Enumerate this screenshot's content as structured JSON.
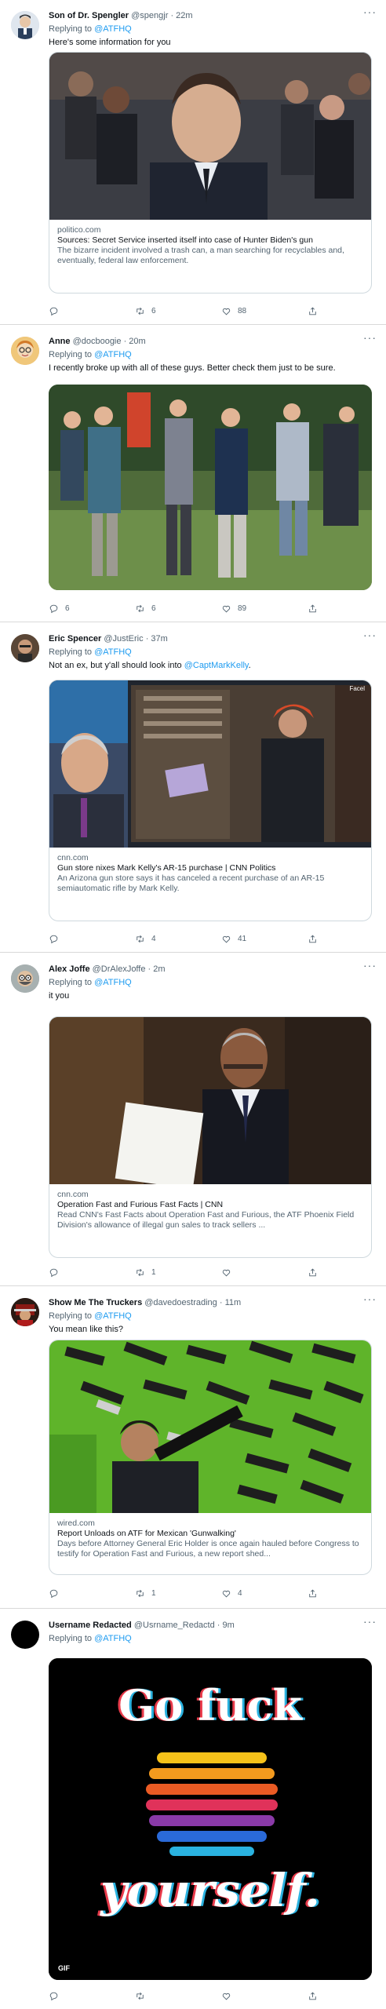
{
  "tweets": [
    {
      "name": "Son of Dr. Spengler",
      "handle": "@spengjr",
      "time": "· 22m",
      "replying_label": "Replying to",
      "replying_to": "@ATFHQ",
      "text": "Here's some information for you",
      "card": {
        "domain": "politico.com",
        "title": "Sources: Secret Service inserted itself into case of Hunter Biden's gun",
        "desc": "The bizarre incident involved a trash can, a man searching for recyclables and, eventually, federal law enforcement."
      },
      "counts": {
        "replies": "",
        "retweets": "6",
        "likes": "88"
      }
    },
    {
      "name": "Anne",
      "handle": "@docboogie",
      "time": "· 20m",
      "replying_label": "Replying to",
      "replying_to": "@ATFHQ",
      "text": "I recently broke up with all of these guys. Better check them just to be sure.",
      "counts": {
        "replies": "6",
        "retweets": "6",
        "likes": "89"
      }
    },
    {
      "name": "Eric Spencer",
      "handle": "@JustEric",
      "time": "· 37m",
      "replying_label": "Replying to",
      "replying_to": "@ATFHQ",
      "text_pre": "Not an ex, but y'all should look into ",
      "text_mention": "@CaptMarkKelly",
      "text_post": ".",
      "card": {
        "domain": "cnn.com",
        "title": "Gun store nixes Mark Kelly's AR-15 purchase | CNN Politics",
        "desc": "An Arizona gun store says it has canceled a recent purchase of an AR-15 semiautomatic rifle by Mark Kelly.",
        "image_tag": "Facel"
      },
      "counts": {
        "replies": "",
        "retweets": "4",
        "likes": "41"
      }
    },
    {
      "name": "Alex Joffe",
      "handle": "@DrAlexJoffe",
      "time": "· 2m",
      "replying_label": "Replying to",
      "replying_to": "@ATFHQ",
      "text": "it you",
      "card": {
        "domain": "cnn.com",
        "title": "Operation Fast and Furious Fast Facts | CNN",
        "desc": "Read CNN's Fast Facts about Operation Fast and Furious, the ATF Phoenix Field Division's allowance of illegal gun sales to track sellers ..."
      },
      "counts": {
        "replies": "",
        "retweets": "1",
        "likes": ""
      }
    },
    {
      "name": "Show Me The Truckers",
      "handle": "@davedoestrading",
      "time": "· 11m",
      "replying_label": "Replying to",
      "replying_to": "@ATFHQ",
      "text": "You mean like this?",
      "card": {
        "domain": "wired.com",
        "title": "Report Unloads on ATF for Mexican 'Gunwalking'",
        "desc": "Days before Attorney General Eric Holder is once again hauled before Congress to testify for Operation Fast and Furious, a new report shed..."
      },
      "counts": {
        "replies": "",
        "retweets": "1",
        "likes": "4"
      }
    },
    {
      "name": "Username Redacted",
      "handle": "@Usrname_Redactd",
      "time": "· 9m",
      "replying_label": "Replying to",
      "replying_to": "@ATFHQ",
      "gif": {
        "line1": "Go fuck",
        "line2": "yourself.",
        "badge": "GIF"
      },
      "counts": {
        "replies": "",
        "retweets": "",
        "likes": ""
      }
    }
  ],
  "colors": {
    "link": "#1d9bf0",
    "muted": "#536471",
    "border": "#cfd9de"
  },
  "icons": [
    "reply-icon",
    "retweet-icon",
    "like-icon",
    "share-icon",
    "more-icon"
  ],
  "more_glyph": "···"
}
